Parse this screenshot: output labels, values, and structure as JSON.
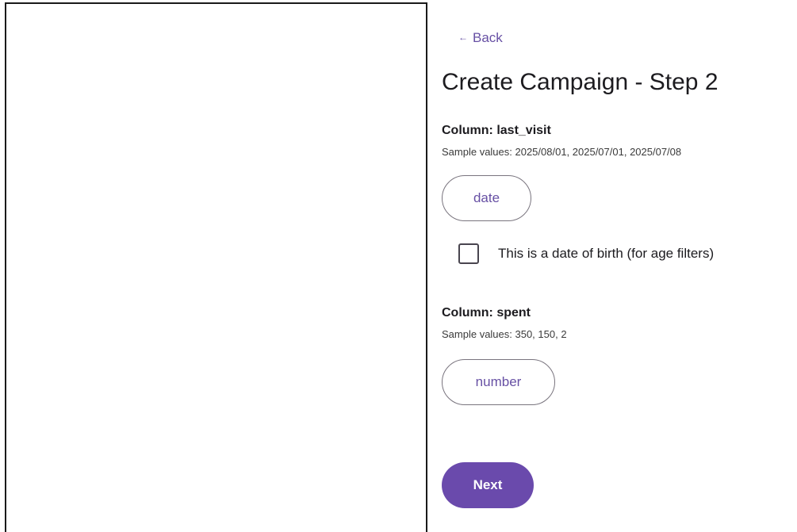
{
  "nav": {
    "back_arrow": "←",
    "back_label": "Back"
  },
  "page": {
    "title": "Create Campaign - Step 2"
  },
  "columns": [
    {
      "title": "Column: last_visit",
      "samples": "Sample values: 2025/08/01, 2025/07/01, 2025/07/08",
      "type_label": "date",
      "dob_checkbox": {
        "label": "This is a date of birth (for age filters)",
        "checked": false
      }
    },
    {
      "title": "Column: spent",
      "samples": "Sample values: 350, 150, 2",
      "type_label": "number"
    }
  ],
  "actions": {
    "next_label": "Next"
  },
  "colors": {
    "accent": "#6750a4",
    "primary_button": "#6a4aac",
    "outline": "#79747e"
  }
}
